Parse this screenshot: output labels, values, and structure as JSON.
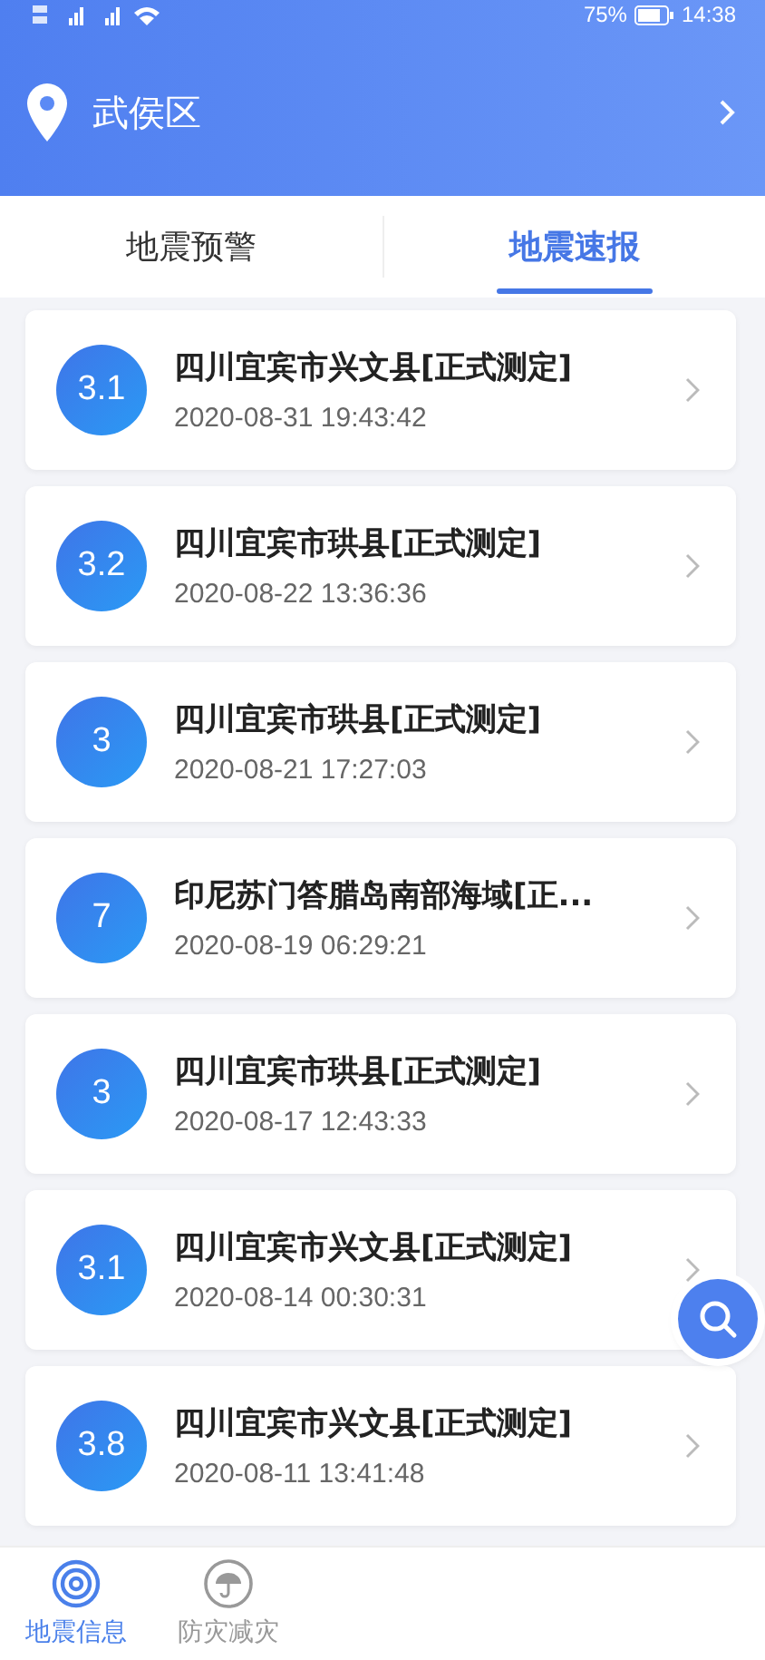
{
  "status_bar": {
    "battery": "75%",
    "time": "14:38"
  },
  "header": {
    "location": "武侯区"
  },
  "tabs": [
    {
      "label": "地震预警",
      "selected": false
    },
    {
      "label": "地震速报",
      "selected": true
    }
  ],
  "quakes": [
    {
      "magnitude": "3.1",
      "place": "四川宜宾市兴文县[正式测定]",
      "time": "2020-08-31 19:43:42"
    },
    {
      "magnitude": "3.2",
      "place": "四川宜宾市珙县[正式测定]",
      "time": "2020-08-22 13:36:36"
    },
    {
      "magnitude": "3",
      "place": "四川宜宾市珙县[正式测定]",
      "time": "2020-08-21 17:27:03"
    },
    {
      "magnitude": "7",
      "place": "印尼苏门答腊岛南部海域[正...",
      "time": "2020-08-19 06:29:21"
    },
    {
      "magnitude": "3",
      "place": "四川宜宾市珙县[正式测定]",
      "time": "2020-08-17 12:43:33"
    },
    {
      "magnitude": "3.1",
      "place": "四川宜宾市兴文县[正式测定]",
      "time": "2020-08-14 00:30:31"
    },
    {
      "magnitude": "3.8",
      "place": "四川宜宾市兴文县[正式测定]",
      "time": "2020-08-11 13:41:48"
    }
  ],
  "bottom_nav": [
    {
      "label": "地震信息",
      "kind": "radar",
      "selected": true
    },
    {
      "label": "防灾减灾",
      "kind": "umbrella",
      "selected": false
    }
  ]
}
